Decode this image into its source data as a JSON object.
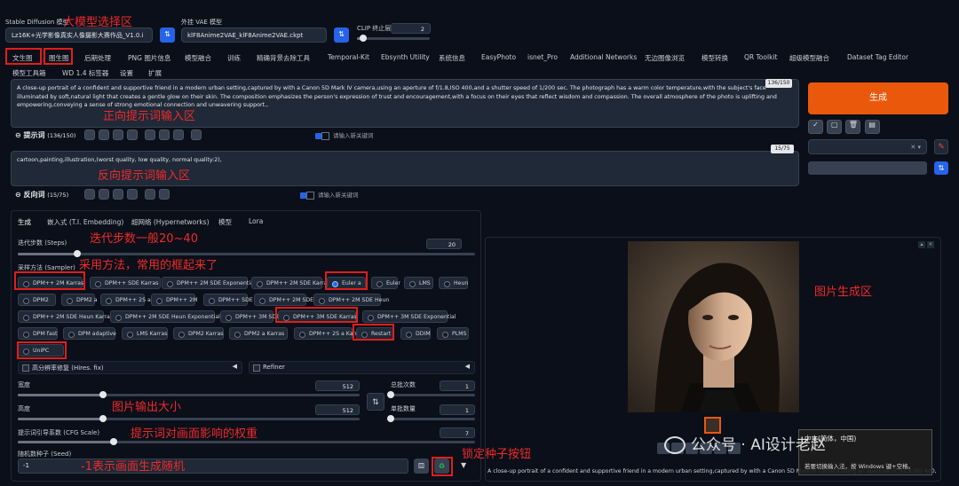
{
  "top": {
    "model_label": "Stable Diffusion 模型",
    "model_value": "Lz16K+光学影像真实人像摄影大赛作品_V1.0.i",
    "vae_label": "外挂 VAE 模型",
    "vae_value": "klF8Anime2VAE_klF8Anime2VAE.ckpt",
    "clip_label": "CLIP 终止层数",
    "clip_value": "2",
    "clip_fraction": 0.08
  },
  "tabs_row1": [
    "文生图",
    "图生图",
    "后期处理",
    "PNG 图片信息",
    "模型融合",
    "训练",
    "精确背景去除工具",
    "Temporal-Kit",
    "Ebsynth Utility",
    "系统信息",
    "EasyPhoto",
    "isnet_Pro",
    "Additional Networks",
    "无边图像浏览",
    "模型转换",
    "QR Toolkit",
    "超级模型融合",
    "Dataset Tag Editor"
  ],
  "tabs_row2": [
    "模型工具箱",
    "WD 1.4 标签器",
    "设置",
    "扩展"
  ],
  "prompt": {
    "text": "A close-up portrait of a confident and supportive friend in a modern urban setting,captured by  with a Canon 5D Mark IV camera,using an aperture of f/1.8,ISO 400,and a shutter speed of 1/200 sec. The photograph has a warm color temperature,with the subject's face illuminated by soft,natural light that creates a gentle glow on their skin. The composition emphasizes the person's expression of trust and encouragement,with a focus on their eyes that reflect wisdom and compassion. The overall atmosphere of the photo is uplifting and empowering,conveying a sense of strong emotional connection and unwavering support.,",
    "counter": "136/150",
    "bar_label": "提示词",
    "bar_count": "(136/150)",
    "check_label": "请输入新关键词"
  },
  "neg": {
    "text": "cartoon,painting,illustration,(worst quality, low quality, normal quality:2),",
    "counter": "15/75",
    "bar_label": "反向词",
    "bar_count": "(15/75)",
    "check_label": "请输入新关键词"
  },
  "generate_label": "生成",
  "subtabs": [
    "生成",
    "嵌入式 (T.I. Embedding)",
    "超网络 (Hypernetworks)",
    "模型",
    "Lora"
  ],
  "steps": {
    "label": "迭代步数 (Steps)",
    "value": "20",
    "fraction": 0.13
  },
  "sampler": {
    "label": "采样方法 (Sampler)",
    "options": [
      "DPM++ 2M Karras",
      "DPM++ SDE Karras",
      "DPM++ 2M SDE Exponential",
      "DPM++ 2M SDE Karras",
      "Euler a",
      "Euler",
      "LMS",
      "Heun",
      "DPM2",
      "DPM2 a",
      "DPM++ 2S a",
      "DPM++ 2M",
      "DPM++ SDE",
      "DPM++ 2M SDE",
      "DPM++ 2M SDE Heun",
      "DPM++ 2M SDE Heun Karras",
      "DPM++ 2M SDE Heun Exponential",
      "DPM++ 3M SDE",
      "DPM++ 3M SDE Karras",
      "DPM++ 3M SDE Exponential",
      "DPM fast",
      "DPM adaptive",
      "LMS Karras",
      "DPM2 Karras",
      "DPM2 a Karras",
      "DPM++ 2S a Karras",
      "Restart",
      "DDIM",
      "PLMS",
      "UniPC"
    ],
    "selected": "Euler a"
  },
  "hires_label": "高分辨率修复 (Hires. fix)",
  "refiner_label": "Refiner",
  "width": {
    "label": "宽度",
    "value": "512",
    "fraction": 0.25
  },
  "height": {
    "label": "高度",
    "value": "512",
    "fraction": 0.25
  },
  "batch_count": {
    "label": "总批次数",
    "value": "1",
    "fraction": 0.0
  },
  "batch_size": {
    "label": "单批数量",
    "value": "1",
    "fraction": 0.0
  },
  "cfg": {
    "label": "提示词引导系数 (CFG Scale)",
    "value": "7",
    "fraction": 0.21
  },
  "seed": {
    "label": "随机数种子 (Seed)",
    "value": "-1"
  },
  "output_caption": "A close-up portrait of a confident and supportive friend in a modern urban setting,captured by with a Canon 5D Mark IV camera,using an aperture of f/1.8,ISO 400,and a shutter speed of 1/200 sec. The photograph has a warm color temperature...",
  "ime": {
    "line1": "中文(简体，中国)",
    "line2": "若要切换输入法，按 Windows 键+空格。"
  },
  "watermark": "公众号 · AI设计老赵",
  "annotations": {
    "model": "大模型选择区",
    "prompt": "正向提示词输入区",
    "neg": "反向提示词输入区",
    "steps": "迭代步数一般20~40",
    "sampler": "采用方法，常用的框起来了",
    "image_area": "图片生成区",
    "size": "图片输出大小",
    "cfg": "提示词对画面影响的权重",
    "seed_btn": "锁定种子按钮",
    "seed": "-1表示画面生成随机"
  },
  "colors": {
    "accent": "#ea580c",
    "blue": "#2563eb",
    "annotation": "#ee2a2a",
    "bg": "#0b0f19"
  }
}
